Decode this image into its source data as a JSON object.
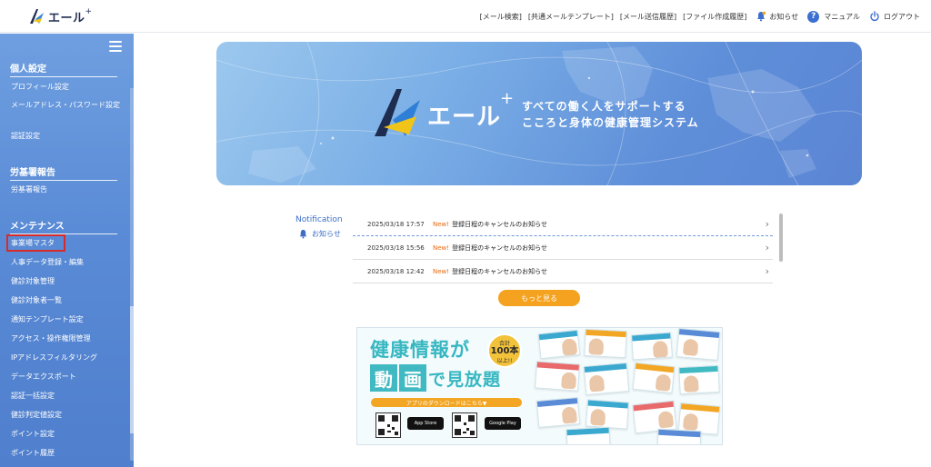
{
  "header": {
    "brand": "エール",
    "brand_plus": "+",
    "nav": [
      "[メール検索]",
      "[共通メールテンプレート]",
      "[メール送信履歴]",
      "[ファイル作成履歴]"
    ],
    "notifications_label": "お知らせ",
    "manual_label": "マニュアル",
    "help_symbol": "?",
    "logout_label": "ログアウト"
  },
  "sidebar": {
    "sections": [
      {
        "title": "個人設定",
        "items": [
          "プロフィール設定",
          "メールアドレス・パスワード設定",
          "認証設定"
        ]
      },
      {
        "title": "労基署報告",
        "items": [
          "労基署報告"
        ]
      },
      {
        "title": "メンテナンス",
        "items": [
          "事業場マスタ",
          "人事データ登録・編集",
          "健診対象管理",
          "健診対象者一覧",
          "通知テンプレート設定",
          "アクセス・操作権限管理",
          "IPアドレスフィルタリング",
          "データエクスポート",
          "認証一括設定",
          "健診判定値設定",
          "ポイント設定",
          "ポイント履歴"
        ]
      }
    ],
    "highlighted_item": "事業場マスタ"
  },
  "banner": {
    "brand": "エール",
    "brand_plus": "+",
    "tagline_1": "すべての働く人をサポートする",
    "tagline_2": "こころと身体の健康管理システム"
  },
  "notification": {
    "heading": "Notification",
    "subheading": "お知らせ",
    "items": [
      {
        "date": "2025/03/18 17:57",
        "badge": "New!",
        "title": "登録日程のキャンセルのお知らせ"
      },
      {
        "date": "2025/03/18 15:56",
        "badge": "New!",
        "title": "登録日程のキャンセルのお知らせ"
      },
      {
        "date": "2025/03/18 12:42",
        "badge": "New!",
        "title": "登録日程のキャンセルのお知らせ"
      }
    ],
    "more_label": "もっと見る"
  },
  "ad": {
    "line1": "健康情報が",
    "box1": "動",
    "box2": "画",
    "line2": "で見放題",
    "badge_top": "合計",
    "badge_num": "100本",
    "badge_bottom": "以上!!",
    "download_bar": "アプリのダウンロードはこちら▼",
    "app_store": "App Store",
    "google_play": "Google Play"
  },
  "colors": {
    "sidebar": "#5a8bd6",
    "accent_orange": "#f4a21f",
    "notif_blue": "#3e6fc7",
    "highlight_red": "#d62b2b",
    "ad_teal": "#36b7c1"
  }
}
